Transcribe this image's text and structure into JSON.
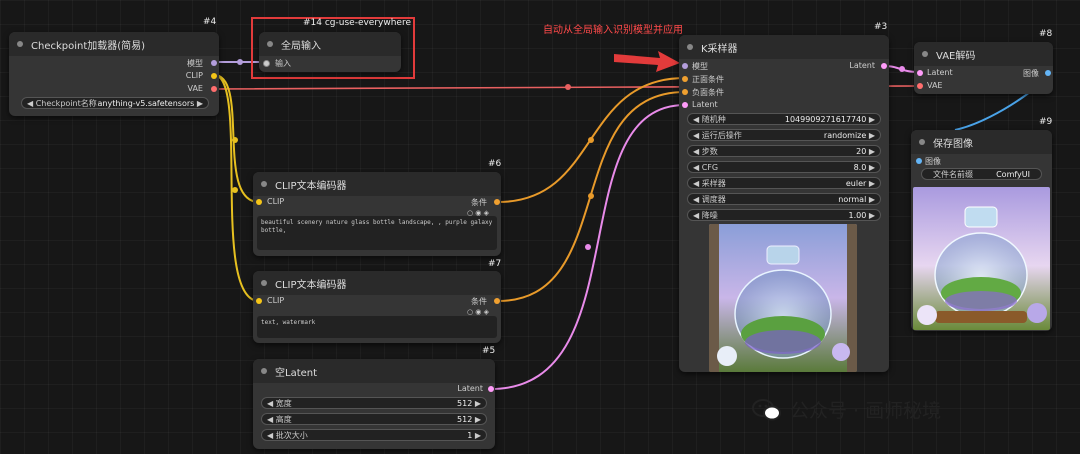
{
  "annotation": {
    "text": "自动从全局输入识别模型并应用"
  },
  "nodes": {
    "checkpoint": {
      "id": "#4",
      "title": "Checkpoint加载器(简易)",
      "outputs": [
        "模型",
        "CLIP",
        "VAE"
      ],
      "widget_label": "Checkpoint名称",
      "widget_value": "anything-v5.safetensors"
    },
    "global_input": {
      "id": "#14 cg-use-everywhere",
      "title": "全局输入",
      "input": "输入"
    },
    "clip_pos": {
      "id": "#6",
      "title": "CLIP文本编码器",
      "input": "CLIP",
      "output": "条件",
      "text": "beautiful scenery nature glass bottle landscape, , purple galaxy bottle,"
    },
    "clip_neg": {
      "id": "#7",
      "title": "CLIP文本编码器",
      "input": "CLIP",
      "output": "条件",
      "text": "text, watermark"
    },
    "latent": {
      "id": "#5",
      "title": "空Latent",
      "output": "Latent",
      "widgets": [
        {
          "label": "宽度",
          "value": "512"
        },
        {
          "label": "高度",
          "value": "512"
        },
        {
          "label": "批次大小",
          "value": "1"
        }
      ]
    },
    "ksampler": {
      "id": "#3",
      "title": "K采样器",
      "inputs": [
        "模型",
        "正面条件",
        "负面条件",
        "Latent"
      ],
      "output": "Latent",
      "widgets": [
        {
          "label": "随机种",
          "value": "1049909271617740"
        },
        {
          "label": "运行后操作",
          "value": "randomize"
        },
        {
          "label": "步数",
          "value": "20"
        },
        {
          "label": "CFG",
          "value": "8.0"
        },
        {
          "label": "采样器",
          "value": "euler"
        },
        {
          "label": "调度器",
          "value": "normal"
        },
        {
          "label": "降噪",
          "value": "1.00"
        }
      ]
    },
    "vae_decode": {
      "id": "#8",
      "title": "VAE解码",
      "inputs": [
        "Latent",
        "VAE"
      ],
      "output": "图像"
    },
    "save_image": {
      "id": "#9",
      "title": "保存图像",
      "input": "图像",
      "widget_label": "文件名前缀",
      "widget_value": "ComfyUI"
    }
  },
  "watermark": {
    "text": "公众号 · 画师秘境"
  },
  "colors": {
    "model": "#b39ddb",
    "clip": "#f5c518",
    "vae": "#ff6e6e",
    "conditioning": "#f0a030",
    "latent": "#ff9cf9",
    "image": "#64b5f6",
    "annotation": "#e23b3b"
  }
}
